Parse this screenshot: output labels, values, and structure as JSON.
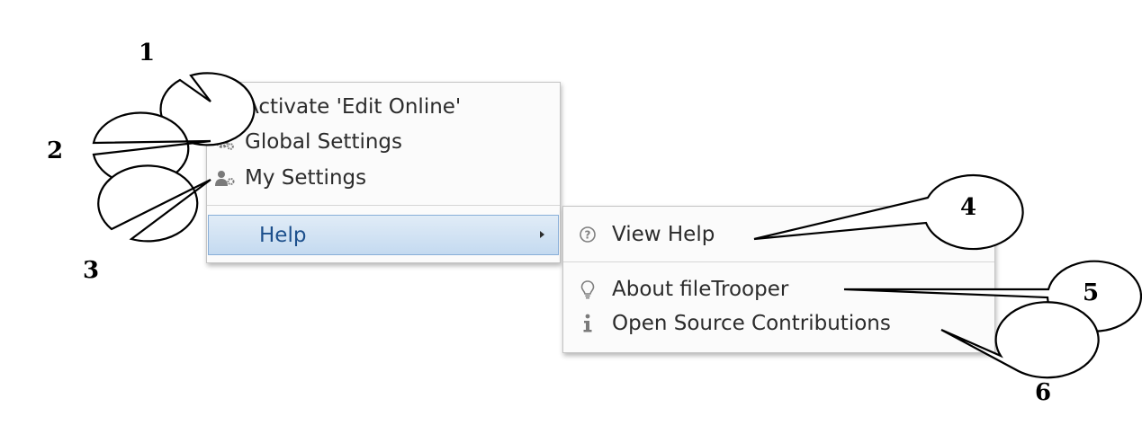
{
  "main_menu": {
    "items": [
      {
        "label": "Activate 'Edit Online'",
        "icon": "globe-icon"
      },
      {
        "label": "Global Settings",
        "icon": "gears-icon"
      },
      {
        "label": "My Settings",
        "icon": "user-settings-icon"
      }
    ],
    "help": {
      "label": "Help",
      "icon": "submenu-arrow-icon"
    }
  },
  "sub_menu": {
    "items": [
      {
        "label": "View Help",
        "icon": "question-circle-icon"
      },
      {
        "label": "About fileTrooper",
        "icon": "lightbulb-icon"
      },
      {
        "label": "Open Source Contributions",
        "icon": "info-icon"
      }
    ]
  },
  "callouts": [
    "1",
    "2",
    "3",
    "4",
    "5",
    "6"
  ]
}
